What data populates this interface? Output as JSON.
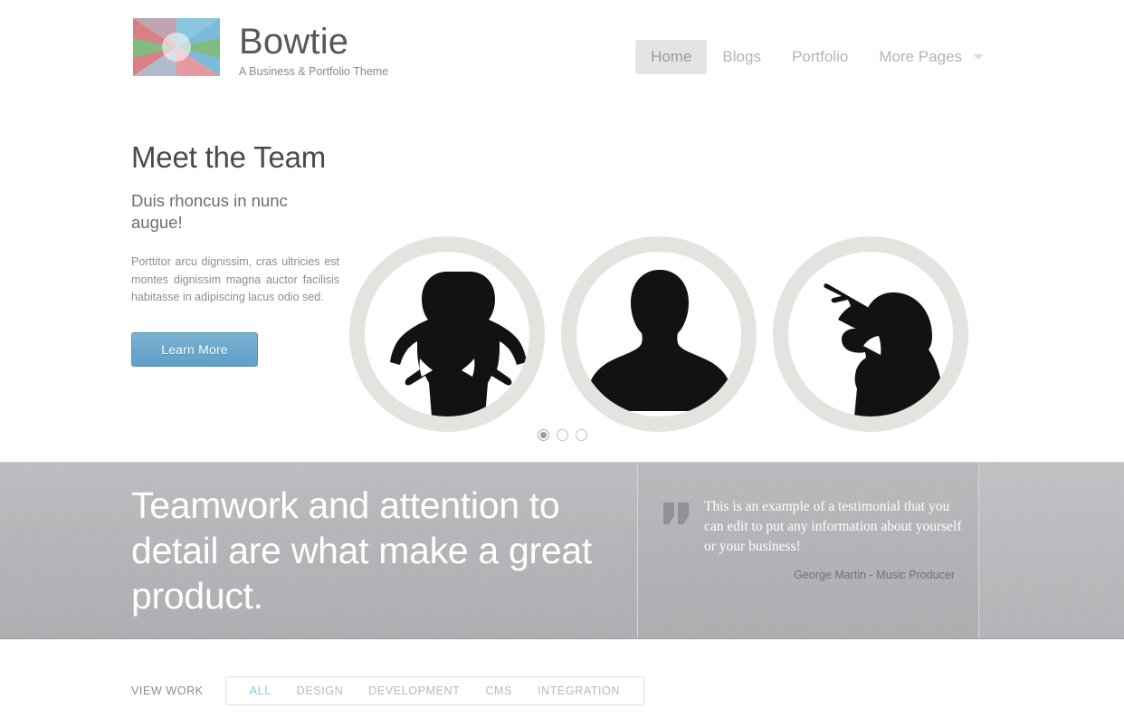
{
  "brand": {
    "title": "Bowtie",
    "tagline": "A Business & Portfolio Theme",
    "logo_icon": "bowtie-logo-icon"
  },
  "nav": {
    "items": [
      {
        "label": "Home",
        "active": true
      },
      {
        "label": "Blogs",
        "active": false
      },
      {
        "label": "Portfolio",
        "active": false
      },
      {
        "label": "More Pages",
        "active": false,
        "caret": true
      }
    ],
    "caret_icon": "chevron-down-icon"
  },
  "hero": {
    "title": "Meet the Team",
    "subtitle": "Duis rhoncus in nunc augue!",
    "body": "Porttitor arcu dignissim, cras ultricies est montes dignissim magna auctor facilisis habitasse in adipiscing lacus odio sed.",
    "cta_label": "Learn More",
    "cta_color": "#6ba6cc",
    "avatars": [
      {
        "icon": "woman-hands-on-hips-silhouette-icon"
      },
      {
        "icon": "man-bust-silhouette-icon"
      },
      {
        "icon": "woman-pointing-silhouette-icon"
      }
    ],
    "carousel": {
      "total": 3,
      "active_index": 0
    }
  },
  "band": {
    "headline": "Teamwork and attention to detail are what make a great product.",
    "background_color": "#b0b2b5",
    "testimonial": {
      "quote_icon": "quotation-mark-icon",
      "text": "This is an example of a testimonial that you can edit to put any information about yourself or your business!",
      "author": "George Martin - Music Producer"
    }
  },
  "portfolio": {
    "label": "VIEW WORK",
    "filters": [
      {
        "label": "ALL",
        "active": true
      },
      {
        "label": "DESIGN",
        "active": false
      },
      {
        "label": "DEVELOPMENT",
        "active": false
      },
      {
        "label": "CMS",
        "active": false
      },
      {
        "label": "INTEGRATION",
        "active": false
      }
    ],
    "active_color": "#8fc2e0"
  }
}
